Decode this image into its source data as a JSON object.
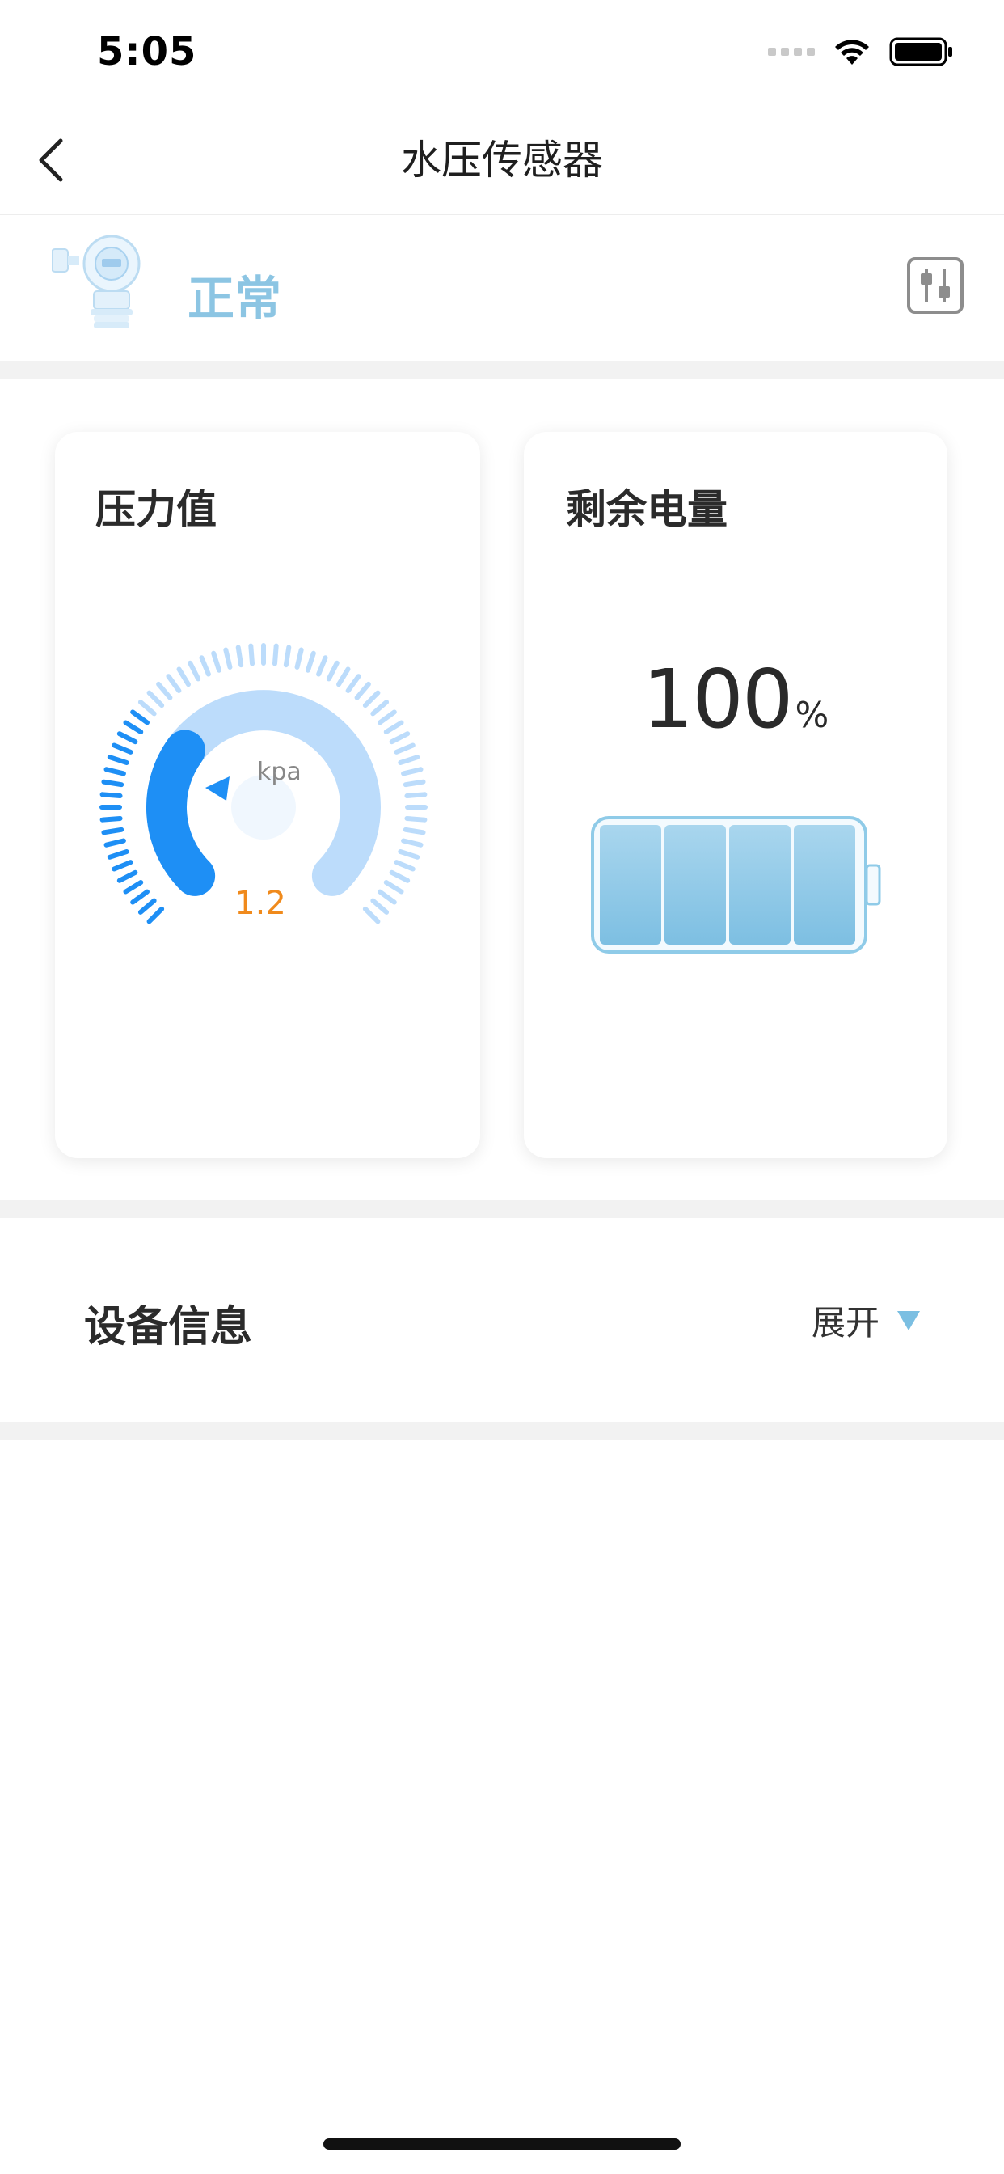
{
  "status_bar": {
    "time": "5:05"
  },
  "nav": {
    "title": "水压传感器",
    "back_icon": "chevron-left-icon"
  },
  "device": {
    "status": "正常",
    "status_color": "#8cc5e3",
    "settings_icon": "sliders-icon"
  },
  "pressure_card": {
    "title": "压力值",
    "unit": "kpa",
    "value": "1.2",
    "value_color": "#f08a1c",
    "gauge_fraction": 0.3
  },
  "battery_card": {
    "title": "剩余电量",
    "percent_value": "100",
    "percent_unit": "%",
    "level_fraction": 1.0,
    "cells_filled": 4
  },
  "device_info": {
    "title": "设备信息",
    "toggle_label": "展开",
    "toggle_icon": "triangle-down-icon"
  },
  "colors": {
    "accent_blue": "#1e8ff5",
    "light_blue": "#bcdcfb",
    "divider": "#f2f2f2"
  }
}
